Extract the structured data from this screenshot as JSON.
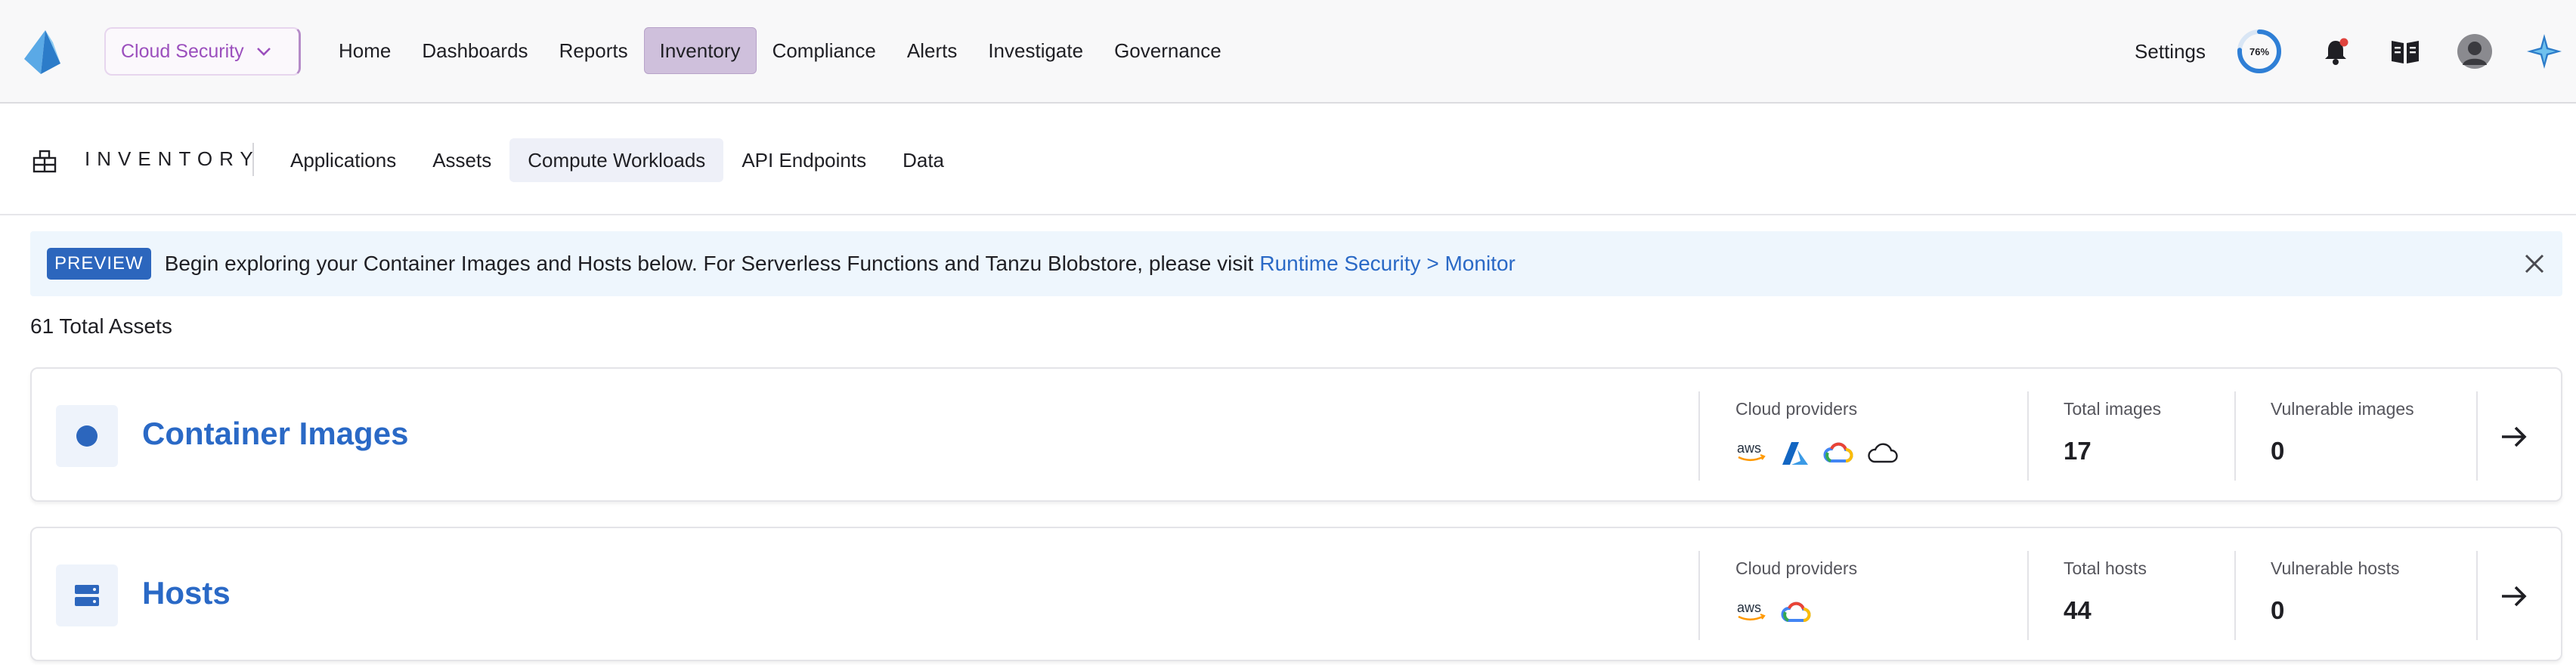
{
  "topnav": {
    "product_switcher": "Cloud Security",
    "items": [
      {
        "label": "Home"
      },
      {
        "label": "Dashboards"
      },
      {
        "label": "Reports"
      },
      {
        "label": "Inventory",
        "active": true
      },
      {
        "label": "Compliance"
      },
      {
        "label": "Alerts"
      },
      {
        "label": "Investigate"
      },
      {
        "label": "Governance"
      }
    ],
    "settings_label": "Settings",
    "progress_label": "76%",
    "progress_value": 0.76
  },
  "subnav": {
    "section_title": "INVENTORY",
    "tabs": [
      {
        "label": "Applications"
      },
      {
        "label": "Assets"
      },
      {
        "label": "Compute Workloads",
        "active": true
      },
      {
        "label": "API Endpoints"
      },
      {
        "label": "Data"
      }
    ]
  },
  "banner": {
    "badge": "PREVIEW",
    "message": "Begin exploring your Container Images and Hosts below. For Serverless Functions and Tanzu Blobstore, please visit",
    "link": "Runtime Security > Monitor"
  },
  "total_assets": "61 Total Assets",
  "cards": [
    {
      "title": "Container Images",
      "icon": "container-image-icon",
      "providers_label": "Cloud providers",
      "providers": [
        "aws-icon",
        "azure-icon",
        "gcp-icon",
        "cloud-icon"
      ],
      "aws_text": "aws",
      "total_label": "Total images",
      "total_value": "17",
      "vuln_label": "Vulnerable images",
      "vuln_value": "0"
    },
    {
      "title": "Hosts",
      "icon": "host-server-icon",
      "providers_label": "Cloud providers",
      "providers": [
        "aws-icon",
        "gcp-icon"
      ],
      "aws_text": "aws",
      "total_label": "Total hosts",
      "total_value": "44",
      "vuln_label": "Vulnerable hosts",
      "vuln_value": "0"
    }
  ],
  "colors": {
    "accent_blue": "#2a69c6",
    "brand_purple": "#9b4fbd",
    "active_nav": "#cfc0dc",
    "banner_bg": "#eef6fd",
    "notification_dot": "#e0443e",
    "progress_ring": "#2f7fd6"
  }
}
